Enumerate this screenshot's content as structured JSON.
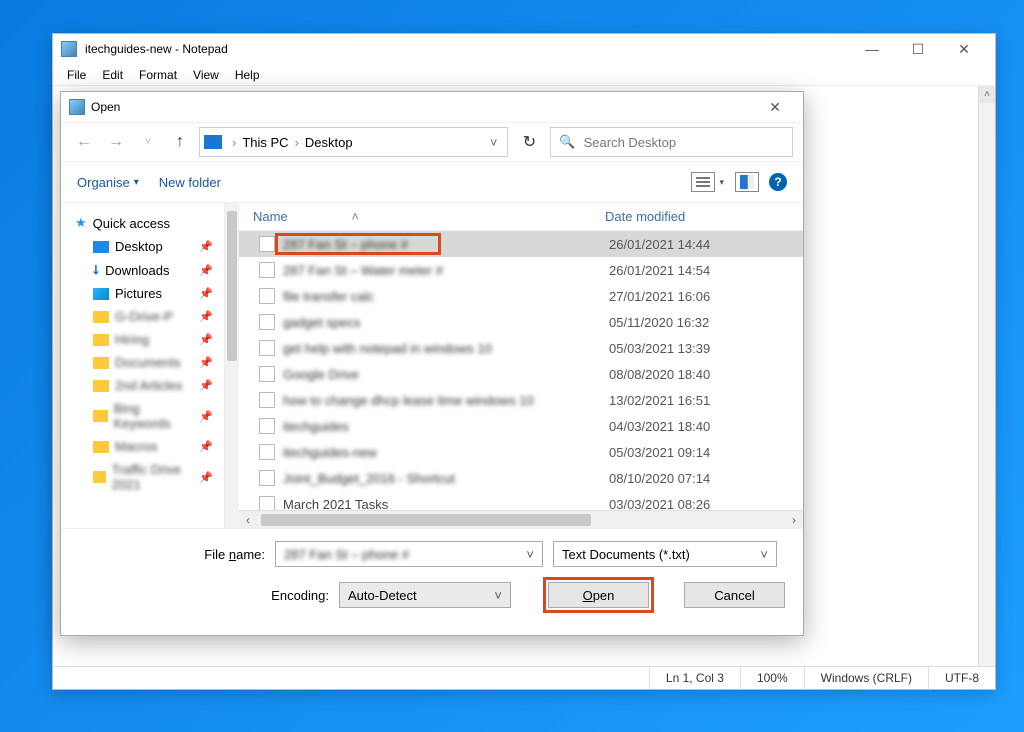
{
  "notepad": {
    "title": "itechguides-new - Notepad",
    "menus": [
      "File",
      "Edit",
      "Format",
      "View",
      "Help"
    ],
    "status": {
      "pos": "Ln 1, Col 3",
      "zoom": "100%",
      "eol": "Windows (CRLF)",
      "enc": "UTF-8"
    }
  },
  "dialog": {
    "title": "Open",
    "breadcrumb": {
      "root": "This PC",
      "folder": "Desktop"
    },
    "search_placeholder": "Search Desktop",
    "toolbar": {
      "organise": "Organise",
      "new_folder": "New folder"
    },
    "columns": {
      "name": "Name",
      "date": "Date modified"
    },
    "sidebar": {
      "quick_access": "Quick access",
      "items": [
        {
          "label": "Desktop",
          "icon": "fc-desktop",
          "blur": false
        },
        {
          "label": "Downloads",
          "icon": "fc-dl",
          "blur": false
        },
        {
          "label": "Pictures",
          "icon": "fc-pic",
          "blur": false
        },
        {
          "label": "G-Drive-P",
          "icon": "fc-folder",
          "blur": true
        },
        {
          "label": "Hiring",
          "icon": "fc-folder",
          "blur": true
        },
        {
          "label": "Documents",
          "icon": "fc-folder",
          "blur": true
        },
        {
          "label": "2nd Articles",
          "icon": "fc-folder",
          "blur": true
        },
        {
          "label": "Bing Keywords",
          "icon": "fc-folder",
          "blur": true
        },
        {
          "label": "Macros",
          "icon": "fc-folder",
          "blur": true
        },
        {
          "label": "Traffic Drive 2021",
          "icon": "fc-folder",
          "blur": true
        }
      ]
    },
    "files": [
      {
        "name": "287 Fan St – phone #",
        "date": "26/01/2021 14:44",
        "blur": true,
        "selected": true
      },
      {
        "name": "287 Fan St – Water meter #",
        "date": "26/01/2021 14:54",
        "blur": true,
        "selected": false
      },
      {
        "name": "file transfer calc",
        "date": "27/01/2021 16:06",
        "blur": true,
        "selected": false
      },
      {
        "name": "gadget specs",
        "date": "05/11/2020 16:32",
        "blur": true,
        "selected": false
      },
      {
        "name": "get help with notepad in windows 10",
        "date": "05/03/2021 13:39",
        "blur": true,
        "selected": false
      },
      {
        "name": "Google Drive",
        "date": "08/08/2020 18:40",
        "blur": true,
        "selected": false
      },
      {
        "name": "how to change dhcp lease time windows 10",
        "date": "13/02/2021 16:51",
        "blur": true,
        "selected": false
      },
      {
        "name": "itechguides",
        "date": "04/03/2021 18:40",
        "blur": true,
        "selected": false
      },
      {
        "name": "itechguides-new",
        "date": "05/03/2021 09:14",
        "blur": true,
        "selected": false
      },
      {
        "name": "Joint_Budget_2016 - Shortcut",
        "date": "08/10/2020 07:14",
        "blur": true,
        "selected": false
      },
      {
        "name": "March 2021 Tasks",
        "date": "03/03/2021 08:26",
        "blur": false,
        "selected": false
      }
    ],
    "filename_lbl_pre": "File ",
    "filename_lbl_hot": "n",
    "filename_lbl_post": "ame:",
    "filename_value": "287 Fan St – phone #",
    "filetype_value": "Text Documents (*.txt)",
    "encoding_label": "Encoding:",
    "encoding_value": "Auto-Detect",
    "open_hot": "O",
    "open_rest": "pen",
    "cancel": "Cancel"
  }
}
